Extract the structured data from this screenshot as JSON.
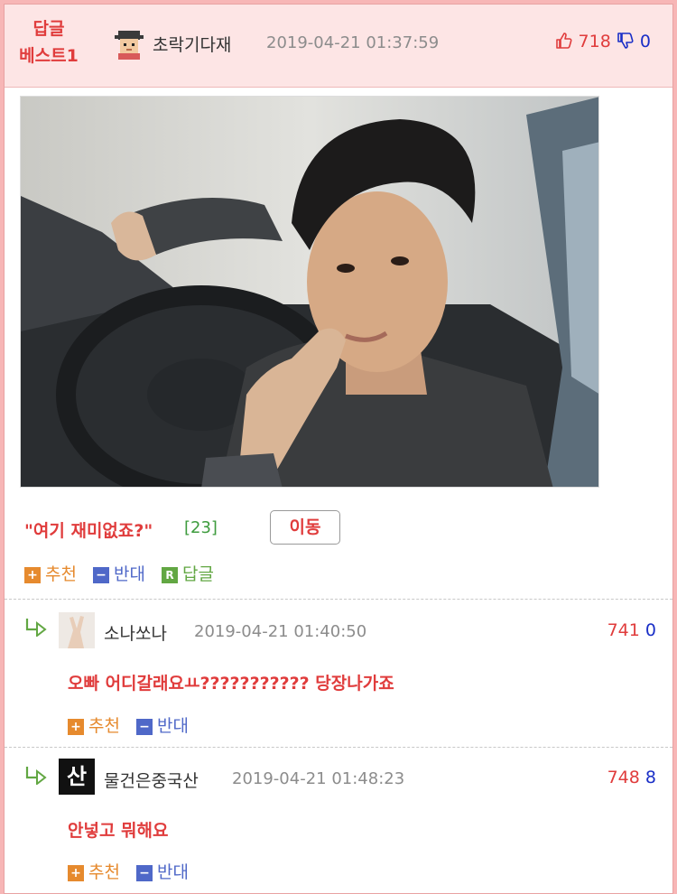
{
  "best": {
    "badge_line1": "답글",
    "badge_line2": "베스트1",
    "author": "초락기다재",
    "datetime": "2019-04-21 01:37:59",
    "upvotes": "718",
    "downvotes": "0",
    "title": "\"여기 재미없죠?\"",
    "reply_count": "[23]",
    "move_label": "이동",
    "recommend_label": "추천",
    "oppose_label": "반대",
    "reply_label": "답글"
  },
  "icons": {
    "plus": "+",
    "minus": "−",
    "reply": "R"
  },
  "replies": [
    {
      "author": "소나쏘나",
      "datetime": "2019-04-21 01:40:50",
      "upvotes": "741",
      "downvotes": "0",
      "text": "오빠 어디갈래요ㅛ??????????? 당장나가죠",
      "recommend_label": "추천",
      "oppose_label": "반대"
    },
    {
      "author": "물건은중국산",
      "datetime": "2019-04-21 01:48:23",
      "upvotes": "748",
      "downvotes": "8",
      "avatar_text": "산",
      "text": "안넣고 뭐해요",
      "recommend_label": "추천",
      "oppose_label": "반대"
    }
  ],
  "colors": {
    "accent_red": "#e03c3c",
    "recommend_orange": "#e68a2e",
    "oppose_blue": "#4f68c8",
    "reply_green": "#62a743",
    "down_blue": "#1a2fc7"
  }
}
